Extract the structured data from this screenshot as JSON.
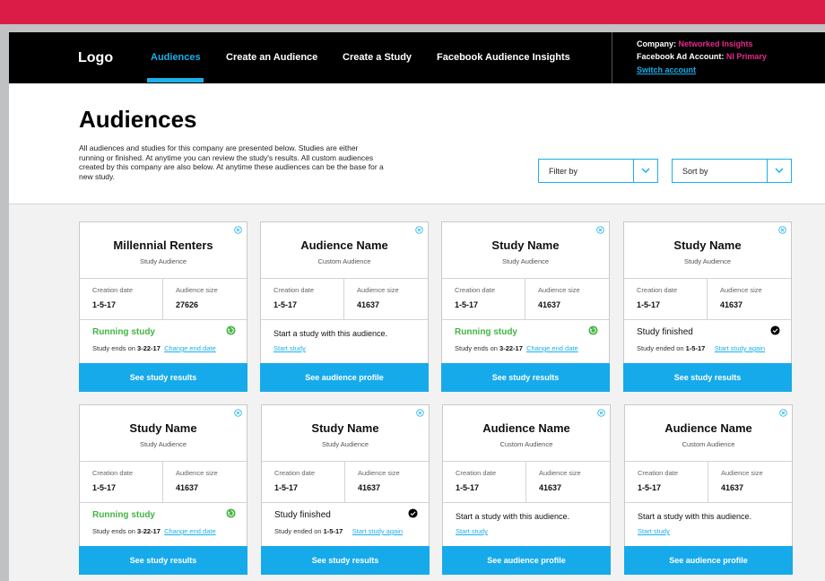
{
  "nav": {
    "logo": "Logo",
    "items": [
      "Audiences",
      "Create an Audience",
      "Create a Study",
      "Facebook Audience Insights"
    ],
    "account": {
      "company_label": "Company:",
      "company_value": "Networked Insights",
      "fb_label": "Facebook Ad Account:",
      "fb_value": "NI Primary",
      "switch": "Switch account"
    }
  },
  "header": {
    "title": "Audiences",
    "description": "All audiences and studies for this company are presented below. Studies are either running or finished. At anytime you can review the study's results. All custom audiences created by this company are also below. At anytime these audiences can be the base for a new study.",
    "filter_label": "Filter by",
    "sort_label": "Sort by"
  },
  "labels": {
    "creation_date": "Creation date",
    "audience_size": "Audience size",
    "study_ends_on": "Study ends on",
    "study_ended_on": "Study ended on",
    "change_end_date": "Change end date",
    "start_study": "Start study",
    "start_study_again": "Start study again"
  },
  "colors": {
    "accent": "#16aaeb",
    "brand_top": "#da1c46",
    "running": "#44b544",
    "account_value": "#e7278c"
  },
  "cards": [
    {
      "name": "Millennial Renters",
      "type": "Study Audience",
      "creation_date": "1-5-17",
      "audience_size": "27626",
      "state": "running",
      "status": "Running study",
      "date": "3-22-17",
      "action": "See study results"
    },
    {
      "name": "Audience Name",
      "type": "Custom Audience",
      "creation_date": "1-5-17",
      "audience_size": "41637",
      "state": "custom",
      "status": "Start a study with this audience.",
      "action": "See audience profile"
    },
    {
      "name": "Study Name",
      "type": "Study Audience",
      "creation_date": "1-5-17",
      "audience_size": "41637",
      "state": "running",
      "status": "Running study",
      "date": "3-22-17",
      "action": "See study results"
    },
    {
      "name": "Study Name",
      "type": "Study Audience",
      "creation_date": "1-5-17",
      "audience_size": "41637",
      "state": "finished",
      "status": "Study finished",
      "date": "1-5-17",
      "action": "See study results"
    },
    {
      "name": "Study Name",
      "type": "Study Audience",
      "creation_date": "1-5-17",
      "audience_size": "41637",
      "state": "running",
      "status": "Running study",
      "date": "3-22-17",
      "action": "See study results"
    },
    {
      "name": "Study Name",
      "type": "Study Audience",
      "creation_date": "1-5-17",
      "audience_size": "41637",
      "state": "finished",
      "status": "Study finished",
      "date": "1-5-17",
      "action": "See study results"
    },
    {
      "name": "Audience Name",
      "type": "Custom Audience",
      "creation_date": "1-5-17",
      "audience_size": "41637",
      "state": "custom",
      "status": "Start a study with this audience.",
      "action": "See audience profile"
    },
    {
      "name": "Audience Name",
      "type": "Custom Audience",
      "creation_date": "1-5-17",
      "audience_size": "41637",
      "state": "custom",
      "status": "Start a study with this audience.",
      "action": "See audience profile"
    }
  ]
}
